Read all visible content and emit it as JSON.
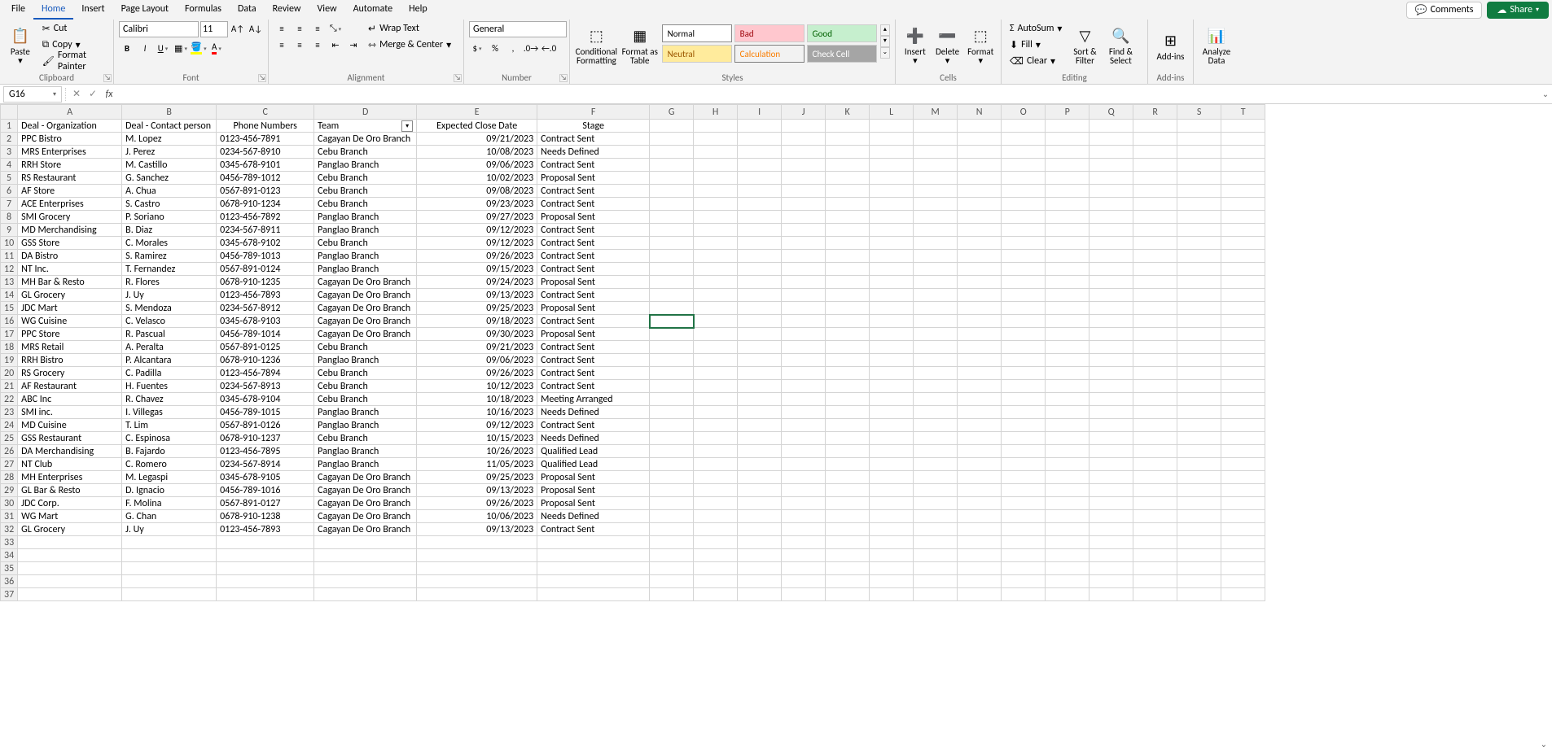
{
  "menu": {
    "items": [
      "File",
      "Home",
      "Insert",
      "Page Layout",
      "Formulas",
      "Data",
      "Review",
      "View",
      "Automate",
      "Help"
    ],
    "active": "Home",
    "comments": "Comments",
    "share": "Share"
  },
  "ribbon": {
    "clipboard": {
      "label": "Clipboard",
      "paste": "Paste",
      "cut": "Cut",
      "copy": "Copy",
      "fp": "Format Painter"
    },
    "font": {
      "label": "Font",
      "name": "Calibri",
      "size": "11"
    },
    "alignment": {
      "label": "Alignment",
      "wrap": "Wrap Text",
      "merge": "Merge & Center"
    },
    "number": {
      "label": "Number",
      "format": "General"
    },
    "styles": {
      "label": "Styles",
      "cf": "Conditional\nFormatting",
      "fat": "Format as\nTable",
      "cells": [
        "Normal",
        "Bad",
        "Good",
        "Neutral",
        "Calculation",
        "Check Cell"
      ]
    },
    "cells": {
      "label": "Cells",
      "insert": "Insert",
      "delete": "Delete",
      "format": "Format"
    },
    "editing": {
      "label": "Editing",
      "autosum": "AutoSum",
      "fill": "Fill",
      "clear": "Clear",
      "sort": "Sort &\nFilter",
      "find": "Find &\nSelect"
    },
    "addins": {
      "label": "Add-ins",
      "btn": "Add-ins"
    },
    "analyze": {
      "label": "",
      "btn": "Analyze\nData"
    }
  },
  "fbar": {
    "namebox": "G16",
    "formula": ""
  },
  "grid": {
    "cols": [
      "A",
      "B",
      "C",
      "D",
      "E",
      "F",
      "G",
      "H",
      "I",
      "J",
      "K",
      "L",
      "M",
      "N",
      "O",
      "P",
      "Q",
      "R",
      "S",
      "T"
    ],
    "selected": {
      "row": 16,
      "col": "G"
    },
    "headers": {
      "A": "Deal - Organization",
      "B": "Deal - Contact person",
      "C": "Phone Numbers",
      "D": "Team",
      "E": "Expected Close Date",
      "F": "Stage"
    },
    "filterCols": [
      "D"
    ],
    "rows": [
      {
        "A": "PPC Bistro",
        "B": "M. Lopez",
        "C": "0123-456-7891",
        "D": "Cagayan De Oro Branch",
        "E": "09/21/2023",
        "F": "Contract Sent"
      },
      {
        "A": "MRS Enterprises",
        "B": "J. Perez",
        "C": "0234-567-8910",
        "D": "Cebu Branch",
        "E": "10/08/2023",
        "F": "Needs Defined"
      },
      {
        "A": "RRH Store",
        "B": "M. Castillo",
        "C": "0345-678-9101",
        "D": "Panglao Branch",
        "E": "09/06/2023",
        "F": "Contract Sent"
      },
      {
        "A": "RS Restaurant",
        "B": "G. Sanchez",
        "C": "0456-789-1012",
        "D": "Cebu Branch",
        "E": "10/02/2023",
        "F": "Proposal Sent"
      },
      {
        "A": "AF Store",
        "B": "A. Chua",
        "C": "0567-891-0123",
        "D": "Cebu Branch",
        "E": "09/08/2023",
        "F": "Contract Sent"
      },
      {
        "A": "ACE Enterprises",
        "B": "S. Castro",
        "C": "0678-910-1234",
        "D": "Cebu Branch",
        "E": "09/23/2023",
        "F": "Contract Sent"
      },
      {
        "A": "SMI Grocery",
        "B": "P. Soriano",
        "C": "0123-456-7892",
        "D": "Panglao Branch",
        "E": "09/27/2023",
        "F": "Proposal Sent"
      },
      {
        "A": "MD Merchandising",
        "B": "B. Diaz",
        "C": "0234-567-8911",
        "D": "Panglao Branch",
        "E": "09/12/2023",
        "F": "Contract Sent"
      },
      {
        "A": "GSS Store",
        "B": "C. Morales",
        "C": "0345-678-9102",
        "D": "Cebu Branch",
        "E": "09/12/2023",
        "F": "Contract Sent"
      },
      {
        "A": "DA Bistro",
        "B": "S. Ramirez",
        "C": "0456-789-1013",
        "D": "Panglao Branch",
        "E": "09/26/2023",
        "F": "Contract Sent"
      },
      {
        "A": "NT Inc.",
        "B": "T. Fernandez",
        "C": "0567-891-0124",
        "D": "Panglao Branch",
        "E": "09/15/2023",
        "F": "Contract Sent"
      },
      {
        "A": "MH Bar & Resto",
        "B": "R. Flores",
        "C": "0678-910-1235",
        "D": "Cagayan De Oro Branch",
        "E": "09/24/2023",
        "F": "Proposal Sent"
      },
      {
        "A": "GL Grocery",
        "B": "J. Uy",
        "C": "0123-456-7893",
        "D": "Cagayan De Oro Branch",
        "E": "09/13/2023",
        "F": "Contract Sent"
      },
      {
        "A": "JDC Mart",
        "B": "S. Mendoza",
        "C": "0234-567-8912",
        "D": "Cagayan De Oro Branch",
        "E": "09/25/2023",
        "F": "Proposal Sent"
      },
      {
        "A": "WG Cuisine",
        "B": "C. Velasco",
        "C": "0345-678-9103",
        "D": "Cagayan De Oro Branch",
        "E": "09/18/2023",
        "F": "Contract Sent"
      },
      {
        "A": "PPC Store",
        "B": "R. Pascual",
        "C": "0456-789-1014",
        "D": "Cagayan De Oro Branch",
        "E": "09/30/2023",
        "F": "Proposal Sent"
      },
      {
        "A": "MRS Retail",
        "B": "A. Peralta",
        "C": "0567-891-0125",
        "D": "Cebu Branch",
        "E": "09/21/2023",
        "F": "Contract Sent"
      },
      {
        "A": "RRH Bistro",
        "B": "P. Alcantara",
        "C": "0678-910-1236",
        "D": "Panglao Branch",
        "E": "09/06/2023",
        "F": "Contract Sent"
      },
      {
        "A": "RS Grocery",
        "B": "C. Padilla",
        "C": "0123-456-7894",
        "D": "Cebu Branch",
        "E": "09/26/2023",
        "F": "Contract Sent"
      },
      {
        "A": "AF Restaurant",
        "B": "H. Fuentes",
        "C": "0234-567-8913",
        "D": "Cebu Branch",
        "E": "10/12/2023",
        "F": "Contract Sent"
      },
      {
        "A": "ABC Inc",
        "B": "R. Chavez",
        "C": "0345-678-9104",
        "D": "Cebu Branch",
        "E": "10/18/2023",
        "F": "Meeting Arranged"
      },
      {
        "A": "SMI inc.",
        "B": "I. Villegas",
        "C": "0456-789-1015",
        "D": "Panglao Branch",
        "E": "10/16/2023",
        "F": "Needs Defined"
      },
      {
        "A": "MD Cuisine",
        "B": "T. Lim",
        "C": "0567-891-0126",
        "D": "Panglao Branch",
        "E": "09/12/2023",
        "F": "Contract Sent"
      },
      {
        "A": "GSS Restaurant",
        "B": "C. Espinosa",
        "C": "0678-910-1237",
        "D": "Cebu Branch",
        "E": "10/15/2023",
        "F": "Needs Defined"
      },
      {
        "A": "DA Merchandising",
        "B": "B. Fajardo",
        "C": "0123-456-7895",
        "D": "Panglao Branch",
        "E": "10/26/2023",
        "F": "Qualified Lead"
      },
      {
        "A": "NT Club",
        "B": "C. Romero",
        "C": "0234-567-8914",
        "D": "Panglao Branch",
        "E": "11/05/2023",
        "F": "Qualified Lead"
      },
      {
        "A": "MH Enterprises",
        "B": "M. Legaspi",
        "C": "0345-678-9105",
        "D": "Cagayan De Oro Branch",
        "E": "09/25/2023",
        "F": "Proposal Sent"
      },
      {
        "A": "GL Bar & Resto",
        "B": "D. Ignacio",
        "C": "0456-789-1016",
        "D": "Cagayan De Oro Branch",
        "E": "09/13/2023",
        "F": "Proposal Sent"
      },
      {
        "A": "JDC Corp.",
        "B": "F. Molina",
        "C": "0567-891-0127",
        "D": "Cagayan De Oro Branch",
        "E": "09/26/2023",
        "F": "Proposal Sent"
      },
      {
        "A": "WG Mart",
        "B": "G. Chan",
        "C": "0678-910-1238",
        "D": "Cagayan De Oro Branch",
        "E": "10/06/2023",
        "F": "Needs Defined"
      },
      {
        "A": "GL Grocery",
        "B": "J. Uy",
        "C": "0123-456-7893",
        "D": "Cagayan De Oro Branch",
        "E": "09/13/2023",
        "F": "Contract Sent"
      }
    ],
    "blankRows": 5
  }
}
